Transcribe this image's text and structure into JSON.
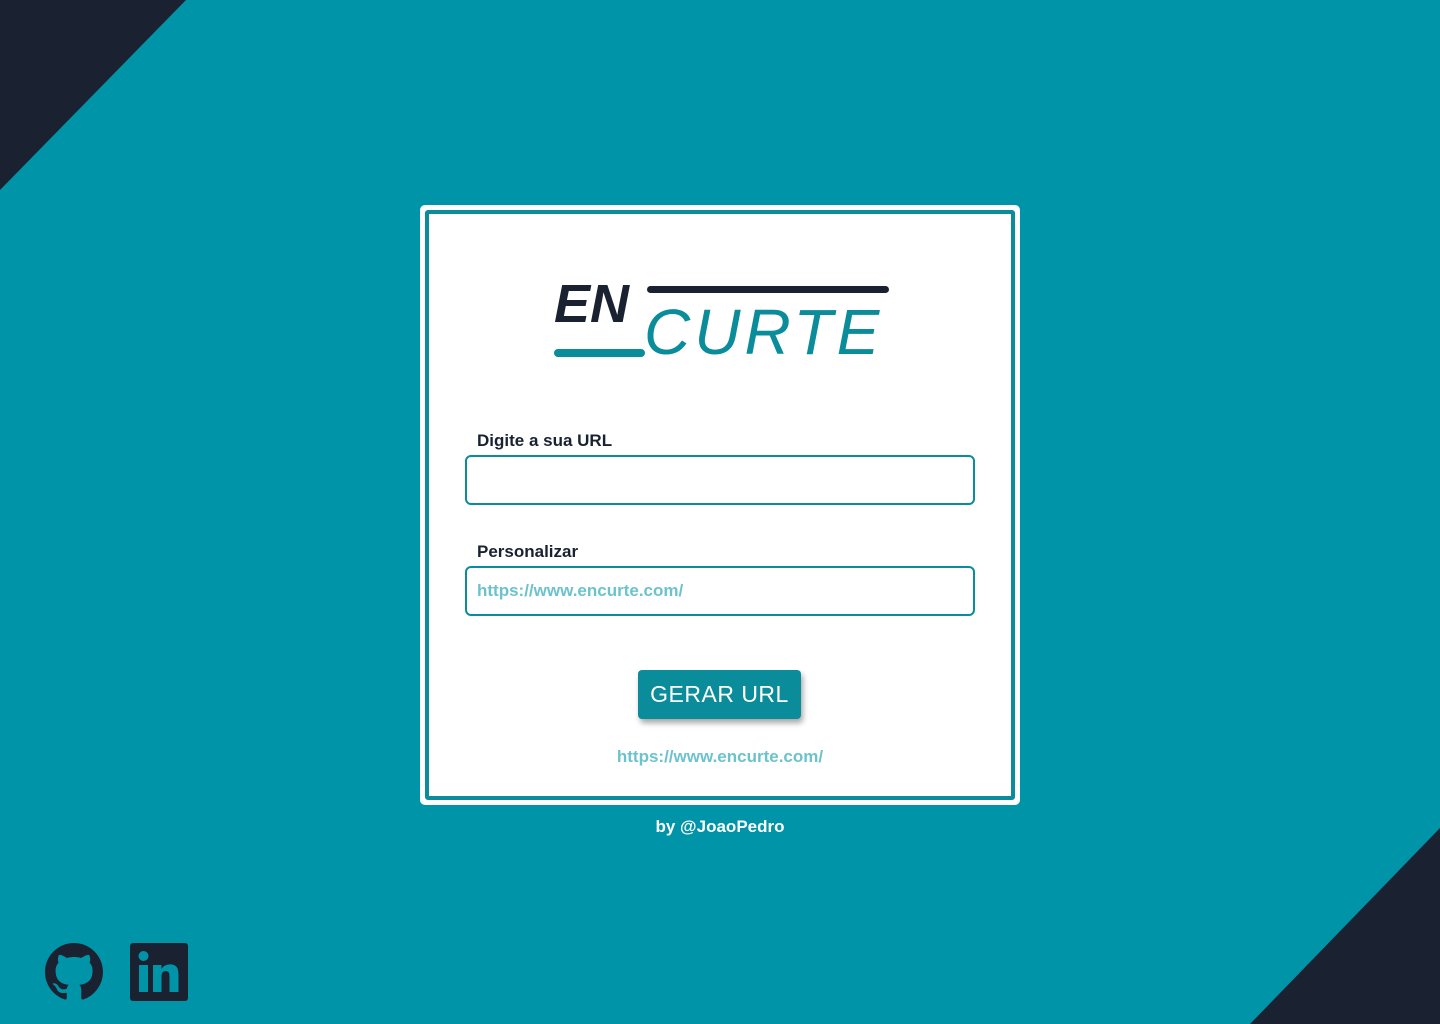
{
  "colors": {
    "background": "#0094a8",
    "dark": "#1a2232",
    "accent": "#0a8c9b",
    "placeholder": "#6cc3cc",
    "card": "#ffffff"
  },
  "logo": {
    "part1": "EN",
    "part2": "CURTE"
  },
  "form": {
    "url_label": "Digite a sua URL",
    "url_value": "",
    "custom_label": "Personalizar",
    "custom_placeholder": "https://www.encurte.com/",
    "submit_label": "GERAR URL"
  },
  "result": {
    "link": "https://www.encurte.com/"
  },
  "footer": {
    "credit": "by @JoaoPedro"
  },
  "social": [
    {
      "icon": "github-icon"
    },
    {
      "icon": "linkedin-icon"
    }
  ]
}
